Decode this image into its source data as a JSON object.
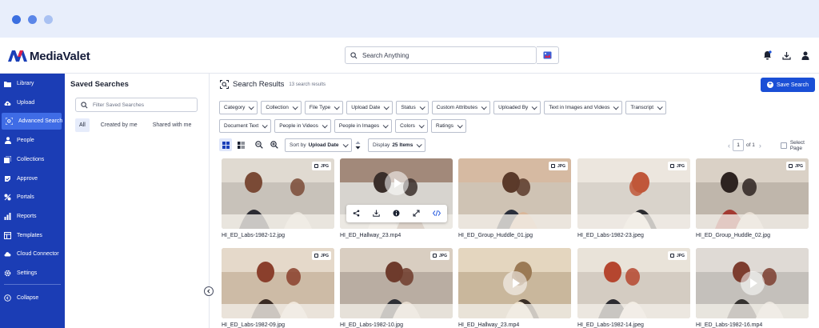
{
  "app": {
    "brand": "MediaValet"
  },
  "header": {
    "search_placeholder": "Search Anything"
  },
  "sidebar": {
    "items": [
      {
        "label": "Library",
        "icon": "folder-icon"
      },
      {
        "label": "Upload",
        "icon": "cloud-upload-icon"
      },
      {
        "label": "Advanced Search",
        "icon": "advanced-search-icon",
        "active": true
      },
      {
        "label": "People",
        "icon": "person-icon"
      },
      {
        "label": "Collections",
        "icon": "collections-icon"
      },
      {
        "label": "Approve",
        "icon": "approve-icon"
      },
      {
        "label": "Portals",
        "icon": "portals-icon"
      },
      {
        "label": "Reports",
        "icon": "reports-icon"
      },
      {
        "label": "Templates",
        "icon": "templates-icon"
      },
      {
        "label": "Cloud Connector",
        "icon": "cloud-icon"
      },
      {
        "label": "Settings",
        "icon": "gear-icon"
      }
    ],
    "collapse": "Collapse"
  },
  "saved_searches": {
    "title": "Saved Searches",
    "filter_placeholder": "Filter Saved Searches",
    "tabs": [
      "All",
      "Created by me",
      "Shared with me"
    ]
  },
  "results": {
    "title": "Search Results",
    "count": "13 search results",
    "save_button": "Save Search",
    "filters_row1": [
      "Category",
      "Collection",
      "File Type",
      "Upload Date",
      "Status",
      "Custom Attributes",
      "Uploaded By",
      "Text in Images and Videos",
      "Transcript"
    ],
    "filters_row2": [
      "Document Text",
      "People in Videos",
      "People in Images",
      "Colors",
      "Ratings"
    ],
    "sort_label": "Sort by",
    "sort_value": "Upload Date",
    "display_label": "Display",
    "display_value": "25 Items",
    "page_current": "1",
    "page_of": "of 1",
    "select_page": "Select Page",
    "assets": [
      {
        "name": "HI_ED_Labs-1982-12.jpg",
        "type": "JPG",
        "video": false
      },
      {
        "name": "HI_ED_Hallway_23.mp4",
        "type": "",
        "video": true,
        "hover": true
      },
      {
        "name": "HI_ED_Group_Huddle_01.jpg",
        "type": "JPG",
        "video": false
      },
      {
        "name": "HI_ED_Labs-1982-23.jpeg",
        "type": "JPG",
        "video": false
      },
      {
        "name": "HI_ED_Group_Huddle_02.jpg",
        "type": "JPG",
        "video": false
      },
      {
        "name": "HI_ED_Labs-1982-09.jpg",
        "type": "JPG",
        "video": false
      },
      {
        "name": "HI_ED_Labs-1982-10.jpg",
        "type": "JPG",
        "video": false
      },
      {
        "name": "HI_ED_Hallway_23.mp4",
        "type": "",
        "video": true
      },
      {
        "name": "HI_ED_Labs-1982-14.jpeg",
        "type": "JPG",
        "video": false
      },
      {
        "name": "HI_ED_Labs-1982-16.mp4",
        "type": "",
        "video": true
      }
    ]
  },
  "colors": {
    "sidebar": "#1b3db5",
    "active": "#3f6ce6",
    "primary": "#1a4fd6"
  }
}
